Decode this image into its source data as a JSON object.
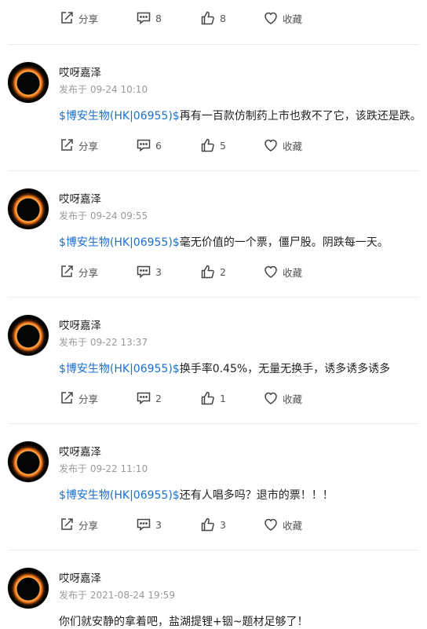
{
  "top_actions": {
    "share": "分享",
    "comments": "8",
    "likes": "8",
    "fav": "收藏"
  },
  "posts": [
    {
      "user": "哎呀嘉泽",
      "time": "发布于 09-24 10:10",
      "stock": "$博安生物(HK|06955)$",
      "text": "再有一百款仿制药上市也救不了它，该跌还是跌。",
      "share": "分享",
      "comments": "6",
      "likes": "5",
      "fav": "收藏"
    },
    {
      "user": "哎呀嘉泽",
      "time": "发布于 09-24 09:55",
      "stock": "$博安生物(HK|06955)$",
      "text": "毫无价值的一个票，僵尸股。阴跌每一天。",
      "share": "分享",
      "comments": "3",
      "likes": "2",
      "fav": "收藏"
    },
    {
      "user": "哎呀嘉泽",
      "time": "发布于 09-22 13:37",
      "stock": "$博安生物(HK|06955)$",
      "text": "换手率0.45%，无量无换手，诱多诱多诱多",
      "share": "分享",
      "comments": "2",
      "likes": "1",
      "fav": "收藏"
    },
    {
      "user": "哎呀嘉泽",
      "time": "发布于 09-22 11:10",
      "stock": "$博安生物(HK|06955)$",
      "text": "还有人唱多吗？退市的票！！！",
      "share": "分享",
      "comments": "3",
      "likes": "3",
      "fav": "收藏"
    },
    {
      "user": "哎呀嘉泽",
      "time": "发布于 2021-08-24 19:59",
      "stock": "",
      "text": "你们就安静的拿着吧，盐湖提锂+铟~题材足够了！"
    }
  ],
  "icons": {
    "share": "share-icon",
    "comment": "comment-icon",
    "like": "thumbs-up-icon",
    "fav": "heart-icon"
  },
  "colors": {
    "stock_link": "#1a6fd1",
    "time": "#999999",
    "divider": "#ececec"
  }
}
